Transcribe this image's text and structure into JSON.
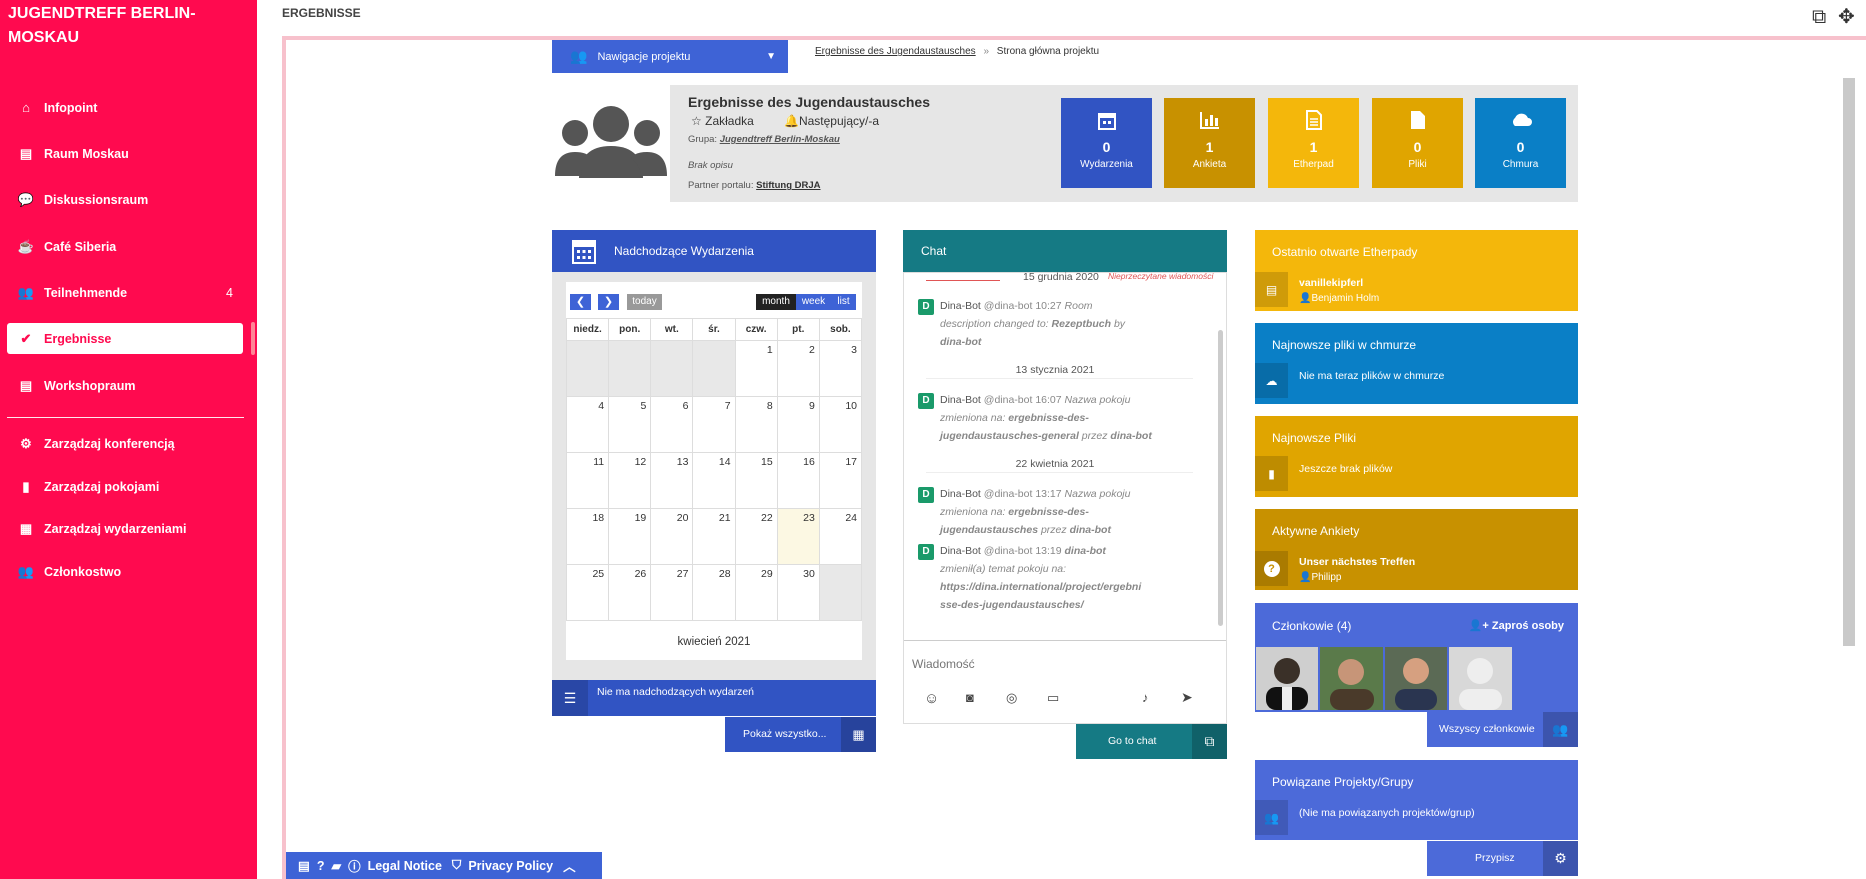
{
  "sidebar": {
    "brand": "JUGENDTREFF BERLIN-MOSKAU",
    "items": [
      {
        "label": "Infopoint",
        "icon": "home-icon"
      },
      {
        "label": "Raum Moskau",
        "icon": "chalkboard-icon"
      },
      {
        "label": "Diskussionsraum",
        "icon": "comments-icon"
      },
      {
        "label": "Café Siberia",
        "icon": "coffee-icon"
      },
      {
        "label": "Teilnehmende",
        "icon": "users-icon",
        "count": "4"
      },
      {
        "label": "Ergebnisse",
        "icon": "check-icon"
      },
      {
        "label": "Workshopraum",
        "icon": "chalkboard-icon"
      }
    ],
    "admin": [
      {
        "label": "Zarządzaj konferencją",
        "icon": "cog-icon"
      },
      {
        "label": "Zarządzaj pokojami",
        "icon": "door-icon"
      },
      {
        "label": "Zarządzaj wydarzeniami",
        "icon": "calendar-icon"
      },
      {
        "label": "Członkostwo",
        "icon": "users-cog-icon"
      }
    ]
  },
  "topbar": {
    "title": "ERGEBNISSE"
  },
  "project_nav": {
    "label": "Nawigacje projektu"
  },
  "breadcrumb": {
    "link": "Ergebnisse des Jugendaustausches",
    "sep": "»",
    "current": "Strona główna projektu"
  },
  "project": {
    "title": "Ergebnisse des Jugendaustausches",
    "bookmark": "Zakładka",
    "follow": "Następujący/-a",
    "group_label": "Grupa:",
    "group": "Jugendtreff Berlin-Moskau",
    "no_desc": "Brak opisu",
    "partner_label": "Partner portalu:",
    "partner": "Stiftung DRJA"
  },
  "tiles": [
    {
      "n": "0",
      "label": "Wydarzenia",
      "color": "#3154c3"
    },
    {
      "n": "1",
      "label": "Ankieta",
      "color": "#c89100"
    },
    {
      "n": "1",
      "label": "Etherpad",
      "color": "#f4b70b"
    },
    {
      "n": "0",
      "label": "Pliki",
      "color": "#e0a500"
    },
    {
      "n": "0",
      "label": "Chmura",
      "color": "#0a7fc6"
    }
  ],
  "events": {
    "title": "Nadchodzące Wydarzenia",
    "today": "today",
    "month": "month",
    "week": "week",
    "list": "list",
    "weekdays": [
      "niedz.",
      "pon.",
      "wt.",
      "śr.",
      "czw.",
      "pt.",
      "sob."
    ],
    "weeks": [
      [
        "",
        "",
        "",
        "",
        "1",
        "2",
        "3"
      ],
      [
        "4",
        "5",
        "6",
        "7",
        "8",
        "9",
        "10"
      ],
      [
        "11",
        "12",
        "13",
        "14",
        "15",
        "16",
        "17"
      ],
      [
        "18",
        "19",
        "20",
        "21",
        "22",
        "23",
        "24"
      ],
      [
        "25",
        "26",
        "27",
        "28",
        "29",
        "30",
        ""
      ]
    ],
    "month_label": "kwiecień 2021",
    "none": "Nie ma nadchodzących wydarzeń",
    "show_all": "Pokaż wszystko..."
  },
  "chat": {
    "title": "Chat",
    "top_date": "15 grudnia 2020",
    "unread": "Nieprzeczytane wiadomości",
    "m1": {
      "who": "Dina-Bot",
      "handle": "@dina-bot",
      "time": "10:27",
      "l1": "Room",
      "l2": "description changed to:",
      "l2b": "Rezeptbuch",
      "l2c": "by",
      "l3": "dina-bot"
    },
    "d2": "13 stycznia 2021",
    "m2": {
      "who": "Dina-Bot",
      "handle": "@dina-bot",
      "time": "16:07",
      "l1": "Nazwa pokoju",
      "l2": "zmieniona na:",
      "l2b": "ergebnisse-des-",
      "l3": "jugendaustausches-general",
      "l3b": "przez",
      "l3c": "dina-bot"
    },
    "d3": "22 kwietnia 2021",
    "m3": {
      "who": "Dina-Bot",
      "handle": "@dina-bot",
      "time": "13:17",
      "l1": "Nazwa pokoju",
      "l2": "zmieniona na:",
      "l2b": "ergebnisse-des-",
      "l3": "jugendaustausches",
      "l3b": "przez",
      "l3c": "dina-bot"
    },
    "m4": {
      "who": "Dina-Bot",
      "handle": "@dina-bot",
      "time": "13:19",
      "l1": "dina-bot",
      "l2": "zmienił(a) temat pokoju na:",
      "l3": "https://dina.international/project/ergebni",
      "l4": "sse-des-jugendaustausches/"
    },
    "placeholder": "Wiadomość",
    "goto": "Go to chat"
  },
  "etherpad": {
    "title": "Ostatnio otwarte Etherpady",
    "item": "vanillekipferl",
    "user": "Benjamin Holm"
  },
  "cloud": {
    "title": "Najnowsze pliki w chmurze",
    "empty": "Nie ma teraz plików w chmurze"
  },
  "files": {
    "title": "Najnowsze Pliki",
    "empty": "Jeszcze brak plików"
  },
  "polls": {
    "title": "Aktywne Ankiety",
    "item": "Unser nächstes Treffen",
    "user": "Philipp"
  },
  "members": {
    "title": "Członkowie (4)",
    "invite": "Zaproś osoby",
    "all": "Wszyscy członkowie"
  },
  "related": {
    "title": "Powiązane Projekty/Grupy",
    "empty": "(Nie ma powiązanych projektów/grup)",
    "pin": "Przypisz"
  },
  "footer": {
    "legal": "Legal Notice",
    "privacy": "Privacy Policy"
  }
}
